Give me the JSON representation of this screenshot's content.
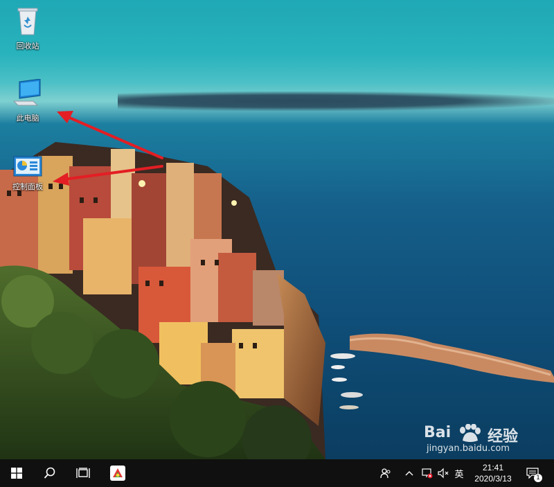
{
  "desktop": {
    "icons": [
      {
        "label": "回收站",
        "icon": "recycle-bin-icon"
      },
      {
        "label": "此电脑",
        "icon": "this-pc-icon"
      },
      {
        "label": "控制面板",
        "icon": "control-panel-icon"
      }
    ]
  },
  "watermark": {
    "brand": "Bai",
    "brand_cn": "经验",
    "url": "jingyan.baidu.com"
  },
  "taskbar": {
    "start_icon": "windows-start-icon",
    "search_icon": "search-icon",
    "task_view_icon": "task-view-icon",
    "pinned_app_icon": "browser-app-icon",
    "tray": {
      "people_icon": "people-icon",
      "chevron_icon": "chevron-up-icon",
      "network_icon": "network-disconnected-icon",
      "volume_icon": "volume-muted-icon",
      "ime_label": "英"
    },
    "clock": {
      "time": "21:41",
      "date": "2020/3/13"
    },
    "notification_count": "1"
  },
  "colors": {
    "taskbar_bg": "#101010",
    "arrow": "#e31e24",
    "sky": "#29b3bd",
    "sea": "#155f8a"
  }
}
